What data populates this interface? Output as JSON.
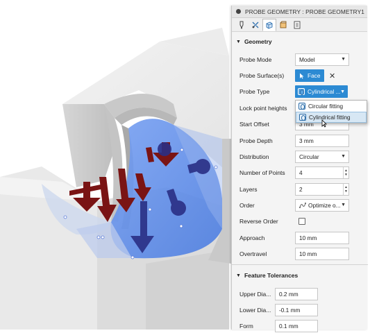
{
  "panel": {
    "title": "PROBE GEOMETRY : PROBE GEOMETRY1",
    "tabs": [
      "probe-icon",
      "settings-icon",
      "geometry-icon",
      "tool-icon",
      "notes-icon"
    ],
    "geometry_section": "Geometry",
    "probe_mode": {
      "label": "Probe Mode",
      "value": "Model"
    },
    "probe_surfaces": {
      "label": "Probe Surface(s)",
      "button": "Face"
    },
    "probe_type": {
      "label": "Probe Type",
      "value": "Cylindrical ..."
    },
    "lock_point_heights": {
      "label": "Lock point heights"
    },
    "start_offset": {
      "label": "Start Offset",
      "value": "3 mm"
    },
    "probe_depth": {
      "label": "Probe Depth",
      "value": "3 mm"
    },
    "distribution": {
      "label": "Distribution",
      "value": "Circular"
    },
    "number_of_points": {
      "label": "Number of Points",
      "value": "4"
    },
    "layers": {
      "label": "Layers",
      "value": "2"
    },
    "order": {
      "label": "Order",
      "value": "Optimize o..."
    },
    "reverse_order": {
      "label": "Reverse Order",
      "checked": false
    },
    "approach": {
      "label": "Approach",
      "value": "10 mm"
    },
    "overtravel": {
      "label": "Overtravel",
      "value": "10 mm"
    },
    "tolerances_section": "Feature Tolerances",
    "upper_dia": {
      "label": "Upper Dia...",
      "value": "0.2 mm"
    },
    "lower_dia": {
      "label": "Lower Dia...",
      "value": "-0.1 mm"
    },
    "form": {
      "label": "Form",
      "value": "0.1 mm"
    }
  },
  "probe_type_dropdown": {
    "options": [
      "Circular fitting",
      "Cylindrical fitting"
    ],
    "selected": "Cylindrical fitting"
  },
  "colors": {
    "accent": "#2c8ad3",
    "surface_highlight": "#5f8fe8",
    "probe_arrows_red": "#7a1414",
    "probe_arrows_navy": "#2a2f85"
  }
}
